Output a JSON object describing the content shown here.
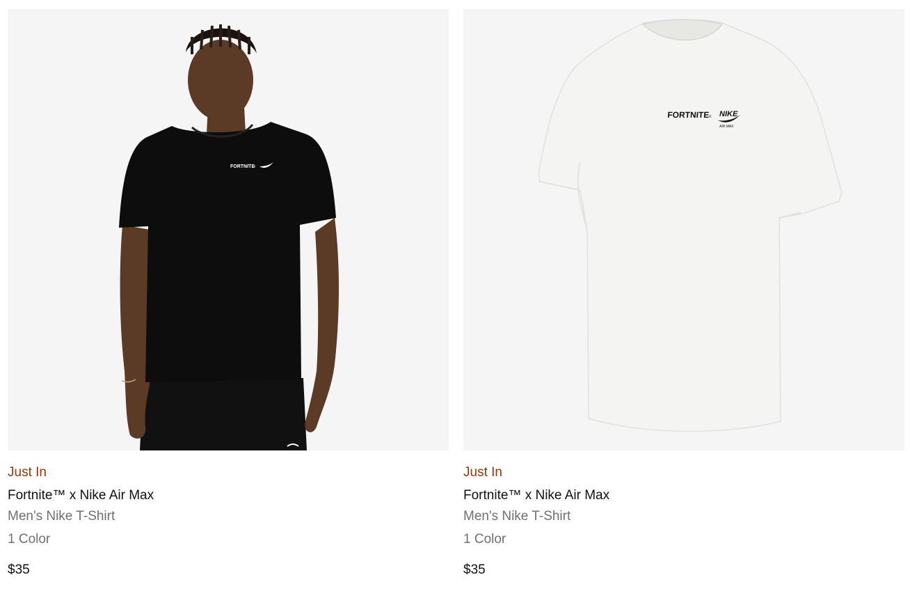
{
  "products": [
    {
      "badge": "Just In",
      "title": "Fortnite™ x Nike Air Max",
      "subtitle": "Men's Nike T-Shirt",
      "colors": "1 Color",
      "price": "$35",
      "image": {
        "icon": "model-black-tshirt-image",
        "shirt_color": "#0d0d0d",
        "logo_color": "#ffffff",
        "logo_text": "FORTNITE"
      }
    },
    {
      "badge": "Just In",
      "title": "Fortnite™ x Nike Air Max",
      "subtitle": "Men's Nike T-Shirt",
      "colors": "1 Color",
      "price": "$35",
      "image": {
        "icon": "white-tshirt-image",
        "shirt_color": "#f4f4f2",
        "logo_color": "#111111",
        "logo_text": "FORTNITE"
      }
    }
  ],
  "theme": {
    "badge_color": "#9e3500",
    "text_primary": "#111111",
    "text_secondary": "#707072",
    "image_bg": "#f5f5f5"
  }
}
